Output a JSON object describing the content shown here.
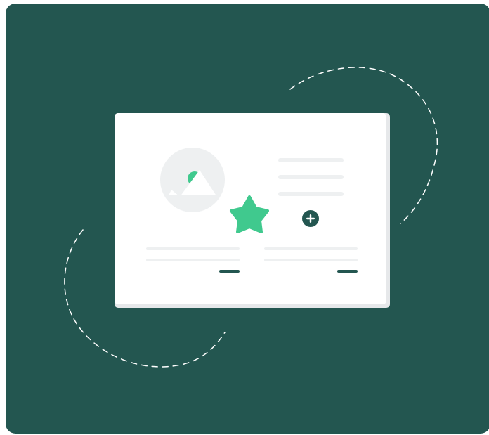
{
  "colors": {
    "background": "#235650",
    "card": "#ffffff",
    "card_shadow": "#e6e8ea",
    "placeholder_line": "#eef0f1",
    "accent_green": "#40c98e",
    "dark_teal": "#235650",
    "dashed_line": "#ffffff"
  },
  "icons": {
    "image_placeholder": "image-placeholder-icon",
    "favorite": "star-icon",
    "add": "plus-icon"
  }
}
